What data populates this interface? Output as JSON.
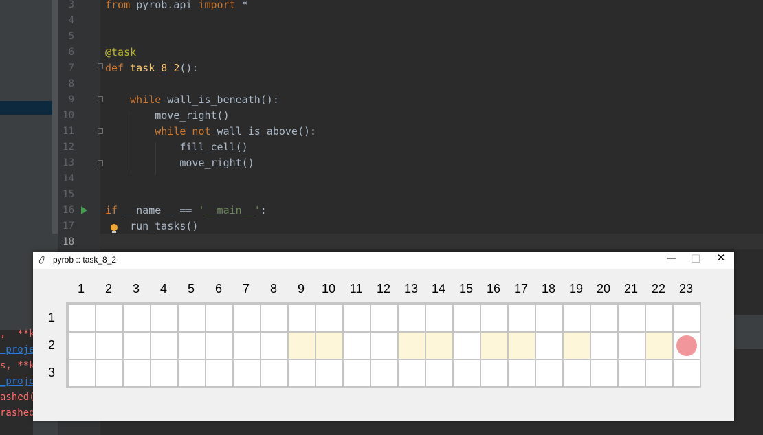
{
  "editor": {
    "lines": [
      {
        "num": "3",
        "parts": [
          {
            "t": "from",
            "c": "kw"
          },
          {
            "t": " pyrob.api ",
            "c": ""
          },
          {
            "t": "import",
            "c": "kw"
          },
          {
            "t": " *",
            "c": ""
          }
        ]
      },
      {
        "num": "4",
        "parts": []
      },
      {
        "num": "5",
        "parts": []
      },
      {
        "num": "6",
        "parts": [
          {
            "t": "@task",
            "c": "dec"
          }
        ]
      },
      {
        "num": "7",
        "parts": [
          {
            "t": "def ",
            "c": "kw"
          },
          {
            "t": "task_8_2",
            "c": "fn"
          },
          {
            "t": "():",
            "c": ""
          }
        ]
      },
      {
        "num": "8",
        "parts": []
      },
      {
        "num": "9",
        "parts": [
          {
            "t": "    ",
            "c": ""
          },
          {
            "t": "while",
            "c": "kw"
          },
          {
            "t": " wall_is_beneath():",
            "c": ""
          }
        ]
      },
      {
        "num": "10",
        "parts": [
          {
            "t": "        move_right()",
            "c": ""
          }
        ]
      },
      {
        "num": "11",
        "parts": [
          {
            "t": "        ",
            "c": ""
          },
          {
            "t": "while not",
            "c": "kw"
          },
          {
            "t": " wall_is_above():",
            "c": ""
          }
        ]
      },
      {
        "num": "12",
        "parts": [
          {
            "t": "            fill_cell()",
            "c": ""
          }
        ]
      },
      {
        "num": "13",
        "parts": [
          {
            "t": "            move_right()",
            "c": ""
          }
        ]
      },
      {
        "num": "14",
        "parts": []
      },
      {
        "num": "15",
        "parts": []
      },
      {
        "num": "16",
        "parts": [
          {
            "t": "if",
            "c": "kw"
          },
          {
            "t": " __name__ == ",
            "c": ""
          },
          {
            "t": "'__main__'",
            "c": "str"
          },
          {
            "t": ":",
            "c": ""
          }
        ]
      },
      {
        "num": "17",
        "parts": [
          {
            "t": "    run_tasks()",
            "c": ""
          }
        ]
      },
      {
        "num": "18",
        "parts": []
      }
    ]
  },
  "console": {
    "lines": [
      {
        "text": ",  **k",
        "style": "red"
      },
      {
        "text": "_proje",
        "style": "link"
      },
      {
        "text": "s, **k",
        "style": "red"
      },
      {
        "text": "_proje",
        "style": "link"
      },
      {
        "text": "ashed(",
        "style": "red"
      },
      {
        "text": "rashed",
        "style": "red"
      }
    ]
  },
  "window": {
    "title": "pyrob :: task_8_2",
    "minimize": "—",
    "maximize": "□",
    "close": "✕",
    "icon": "feather-icon"
  },
  "board": {
    "columns": [
      "1",
      "2",
      "3",
      "4",
      "5",
      "6",
      "7",
      "8",
      "9",
      "10",
      "11",
      "12",
      "13",
      "14",
      "15",
      "16",
      "17",
      "18",
      "19",
      "20",
      "21",
      "22",
      "23"
    ],
    "rows": [
      "1",
      "2",
      "3"
    ],
    "filled_cells": [
      [
        2,
        9
      ],
      [
        2,
        10
      ],
      [
        2,
        13
      ],
      [
        2,
        14
      ],
      [
        2,
        16
      ],
      [
        2,
        17
      ],
      [
        2,
        19
      ],
      [
        2,
        22
      ]
    ],
    "robot_position": [
      2,
      23
    ],
    "colors": {
      "filled": "#fdf6d8",
      "robot": "#f1969b",
      "wall": "#c6c6c6"
    }
  }
}
